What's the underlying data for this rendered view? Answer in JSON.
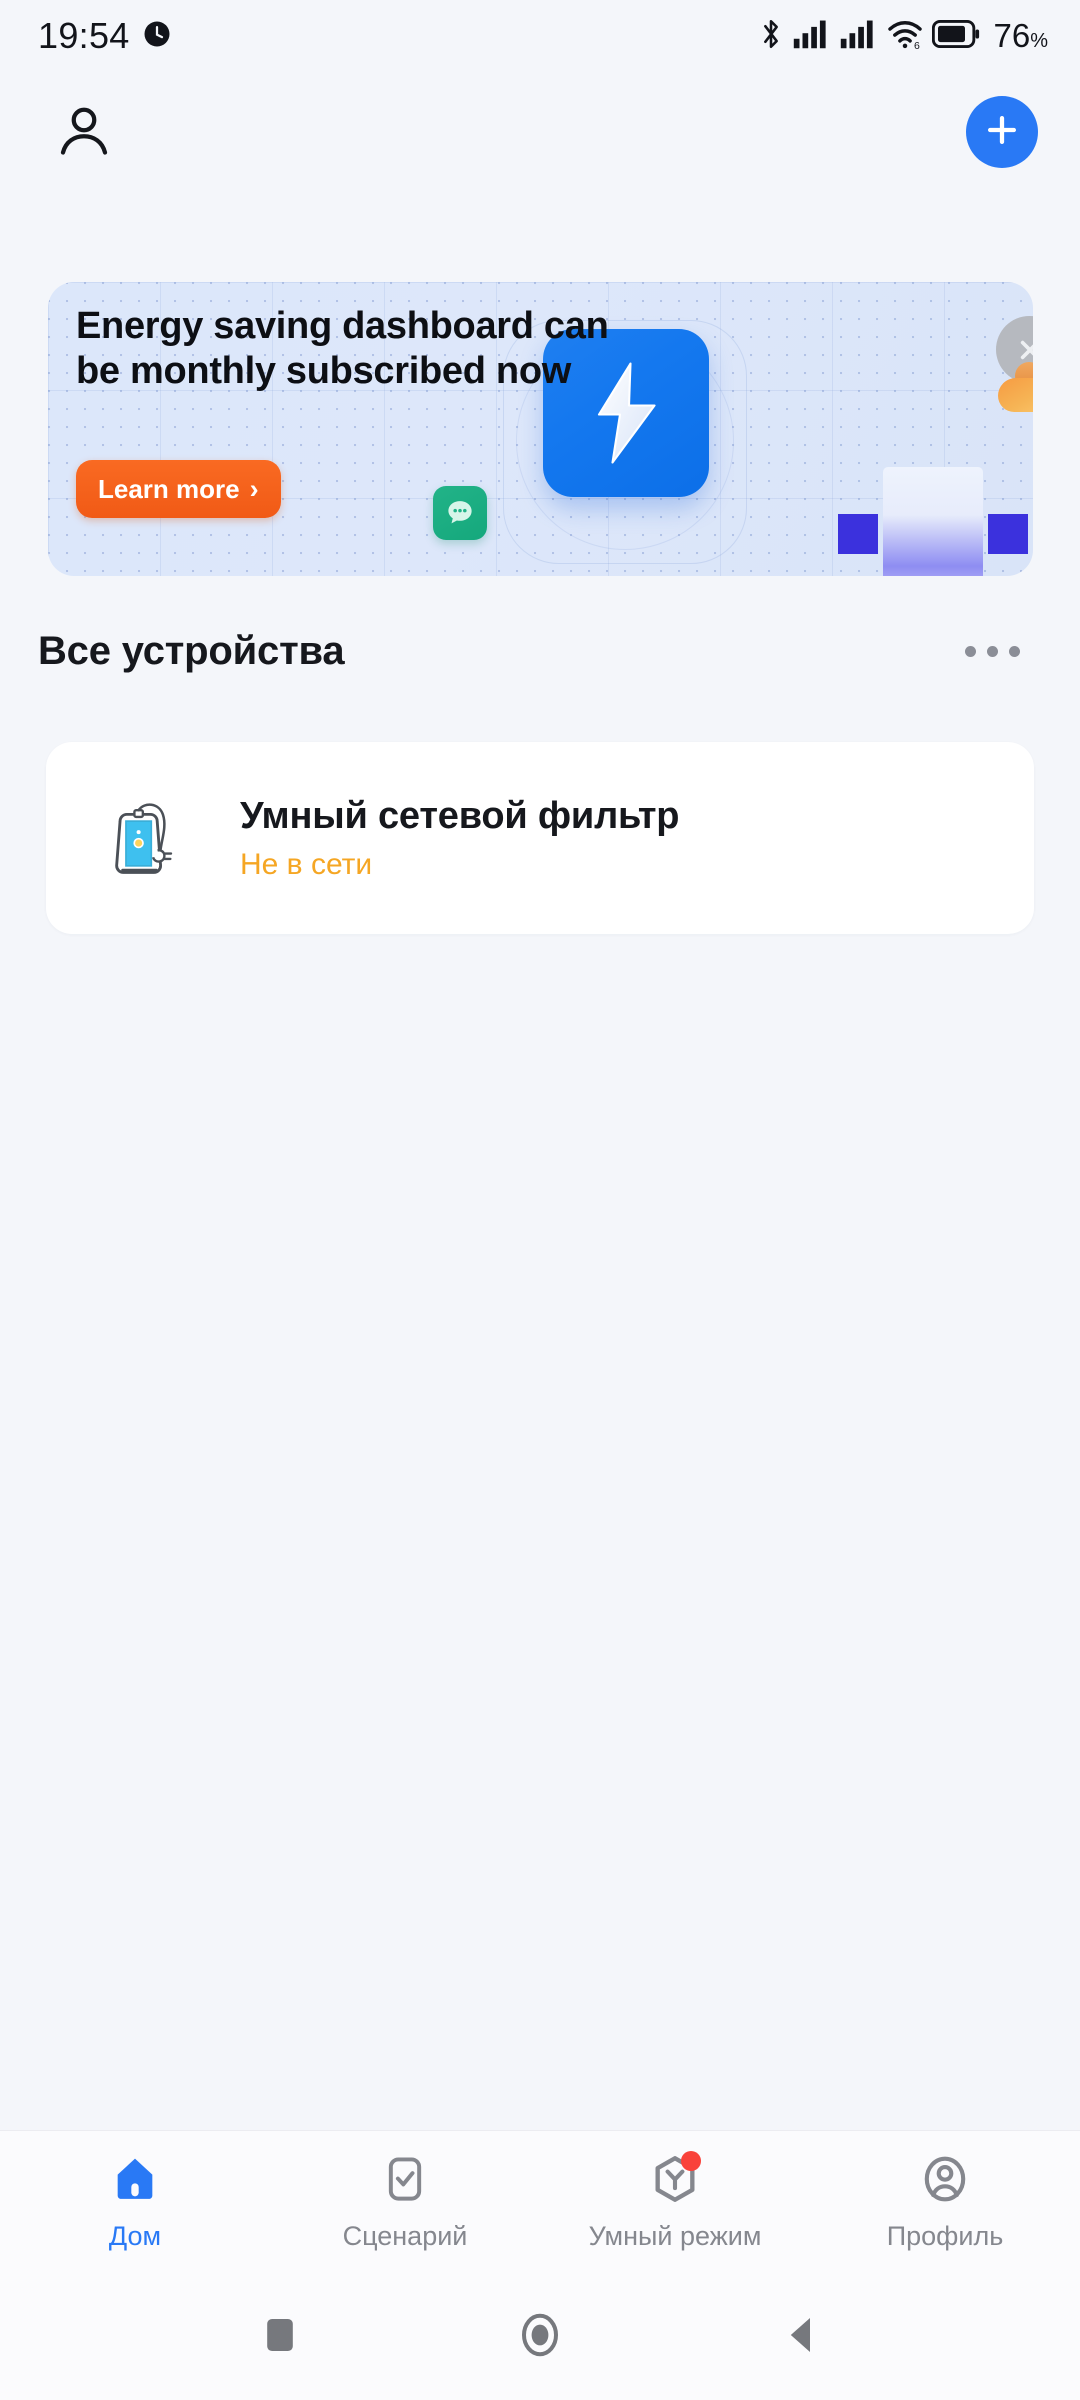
{
  "status_bar": {
    "time": "19:54",
    "battery_percent": "76",
    "percent_symbol": "%",
    "icons": [
      "alarm-clock-icon",
      "bluetooth-icon",
      "signal-bars-sim1-icon",
      "signal-bars-sim2-icon",
      "wifi-6-icon",
      "battery-icon"
    ]
  },
  "top_bar": {
    "avatar_icon": "user-avatar-icon",
    "add_icon": "plus-icon"
  },
  "banner": {
    "title": "Energy saving dashboard can be monthly subscribed now",
    "cta_label": "Learn more",
    "cta_chevron": "›",
    "art": {
      "bolt_icon": "lightning-bolt-icon",
      "chat_icon": "chat-bubble-icon",
      "close_icon": "close-x-icon",
      "person_icon": "person-blob-icon"
    },
    "colors": {
      "background": "#dce7fa",
      "cta": "#f5631e",
      "tile": "#1478ef",
      "chat_tile": "#17a97d",
      "indigo": "#3b31dd"
    }
  },
  "devices_section": {
    "title": "Все устройства",
    "more_icon": "more-horizontal-icon",
    "items": [
      {
        "name": "Умный сетевой фильтр",
        "status": "Не в сети",
        "status_color": "#f5a623",
        "icon": "power-strip-icon"
      }
    ]
  },
  "bottom_nav": {
    "active_color": "#2979f5",
    "inactive_color": "#85878e",
    "items": [
      {
        "label": "Дом",
        "icon": "home-icon",
        "active": true,
        "badge": false
      },
      {
        "label": "Сценарий",
        "icon": "checkbox-square-icon",
        "active": false,
        "badge": false
      },
      {
        "label": "Умный режим",
        "icon": "hexagon-y-icon",
        "active": false,
        "badge": true
      },
      {
        "label": "Профиль",
        "icon": "person-circle-icon",
        "active": false,
        "badge": false
      }
    ]
  },
  "system_nav": {
    "buttons": [
      {
        "icon": "recents-square-icon"
      },
      {
        "icon": "home-circle-icon"
      },
      {
        "icon": "back-triangle-icon"
      }
    ]
  }
}
